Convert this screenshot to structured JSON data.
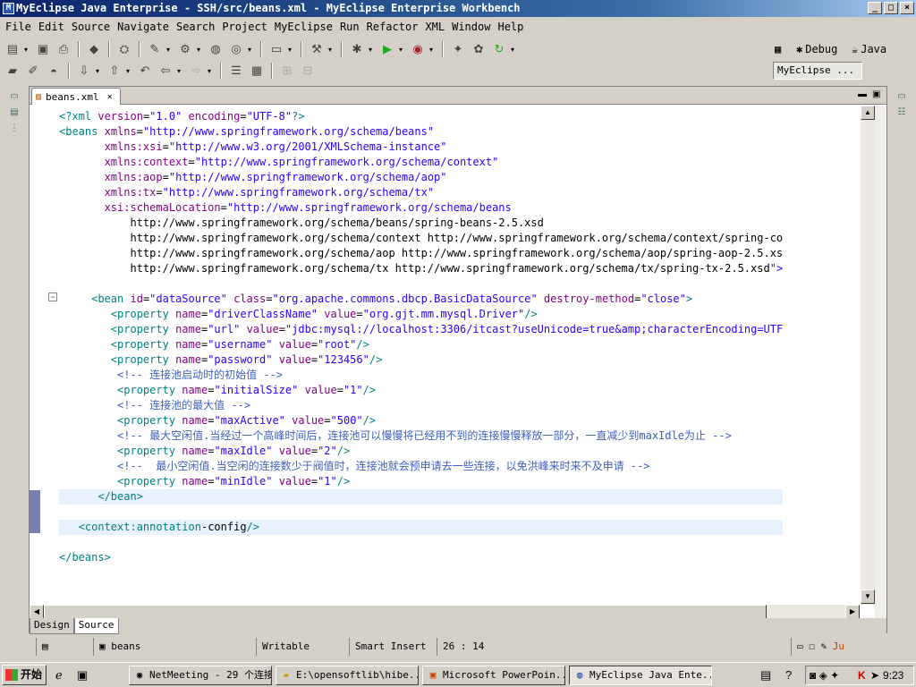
{
  "window": {
    "title": "MyEclipse Java Enterprise - SSH/src/beans.xml - MyEclipse Enterprise Workbench",
    "controls": [
      "_",
      "□",
      "×"
    ]
  },
  "menubar": [
    "File",
    "Edit",
    "Source",
    "Navigate",
    "Search",
    "Project",
    "MyEclipse",
    "Run",
    "Refactor",
    "XML",
    "Window",
    "Help"
  ],
  "perspectives": {
    "debug_label": "Debug",
    "java_label": "Java",
    "active_label": "MyEclipse ..."
  },
  "editor": {
    "tab_label": "beans.xml",
    "bottom_tabs": [
      "Design",
      "Source"
    ],
    "active_bottom_tab": "Source",
    "lines": [
      [
        "<?xml version=\"1.0\" encoding=\"UTF-8\"?>"
      ],
      [
        "<beans xmlns=\"http://www.springframework.org/schema/beans\""
      ],
      [
        "       xmlns:xsi=\"http://www.w3.org/2001/XMLSchema-instance\""
      ],
      [
        "       xmlns:context=\"http://www.springframework.org/schema/context\""
      ],
      [
        "       xmlns:aop=\"http://www.springframework.org/schema/aop\""
      ],
      [
        "       xmlns:tx=\"http://www.springframework.org/schema/tx\""
      ],
      [
        "       xsi:schemaLocation=\"http://www.springframework.org/schema/beans"
      ],
      [
        "           http://www.springframework.org/schema/beans/spring-beans-2.5.xsd"
      ],
      [
        "           http://www.springframework.org/schema/context http://www.springframework.org/schema/context/spring-co"
      ],
      [
        "           http://www.springframework.org/schema/aop http://www.springframework.org/schema/aop/spring-aop-2.5.xs"
      ],
      [
        "           http://www.springframework.org/schema/tx http://www.springframework.org/schema/tx/spring-tx-2.5.xsd\">"
      ],
      [
        ""
      ],
      [
        "     <bean id=\"dataSource\" class=\"org.apache.commons.dbcp.BasicDataSource\" destroy-method=\"close\">"
      ],
      [
        "        <property name=\"driverClassName\" value=\"org.gjt.mm.mysql.Driver\"/>"
      ],
      [
        "        <property name=\"url\" value=\"jdbc:mysql://localhost:3306/itcast?useUnicode=true&amp;characterEncoding=UTF"
      ],
      [
        "        <property name=\"username\" value=\"root\"/>"
      ],
      [
        "        <property name=\"password\" value=\"123456\"/>"
      ],
      [
        "         <!-- 连接池启动时的初始值 -->"
      ],
      [
        "         <property name=\"initialSize\" value=\"1\"/>"
      ],
      [
        "         <!-- 连接池的最大值 -->"
      ],
      [
        "         <property name=\"maxActive\" value=\"500\"/>"
      ],
      [
        "         <!-- 最大空闲值.当经过一个高峰时间后，连接池可以慢慢将已经用不到的连接慢慢释放一部分，一直减少到maxIdle为止 -->"
      ],
      [
        "         <property name=\"maxIdle\" value=\"2\"/>"
      ],
      [
        "         <!--  最小空闲值.当空闲的连接数少于阀值时，连接池就会预申请去一些连接，以免洪峰来时来不及申请 -->"
      ],
      [
        "         <property name=\"minIdle\" value=\"1\"/>"
      ],
      [
        "      </bean>"
      ],
      [
        ""
      ],
      [
        "   <context:annotation-config/>"
      ],
      [
        ""
      ],
      [
        "</beans>"
      ]
    ]
  },
  "statusbar": {
    "file_label": "beans",
    "writable": "Writable",
    "insert_mode": "Smart Insert",
    "position": "26 : 14"
  },
  "taskbar": {
    "start_label": "开始",
    "buttons": [
      "NetMeeting - 29 个连接",
      "E:\\opensoftlib\\hibe...",
      "Microsoft PowerPoin...",
      "MyEclipse Java Ente..."
    ],
    "clock": "9:23"
  }
}
